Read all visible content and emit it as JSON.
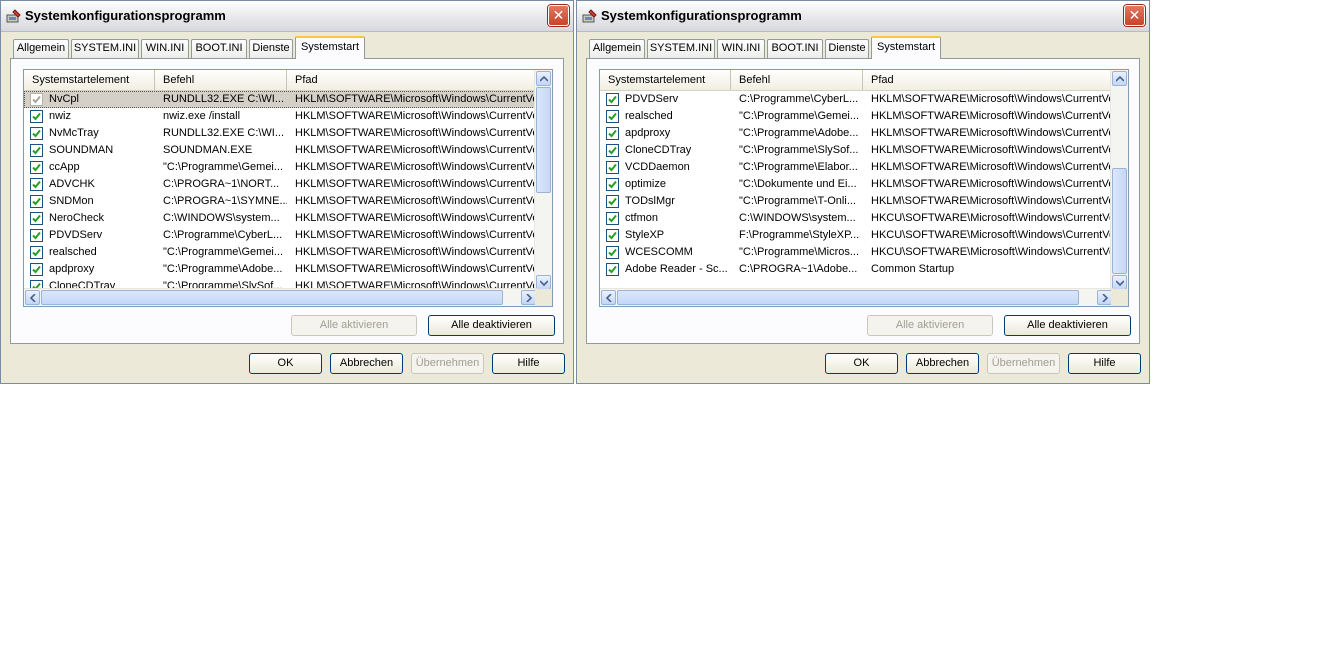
{
  "windows": [
    {
      "title": "Systemkonfigurationsprogramm",
      "tabs": [
        "Allgemein",
        "SYSTEM.INI",
        "WIN.INI",
        "BOOT.INI",
        "Dienste",
        "Systemstart"
      ],
      "active_tab": "Systemstart",
      "columns": [
        "Systemstartelement",
        "Befehl",
        "Pfad"
      ],
      "rows": [
        {
          "name": "NvCpl",
          "cmd": "RUNDLL32.EXE C:\\WI...",
          "path": "HKLM\\SOFTWARE\\Microsoft\\Windows\\CurrentVer...",
          "checked": true,
          "selected": true
        },
        {
          "name": "nwiz",
          "cmd": "nwiz.exe /install",
          "path": "HKLM\\SOFTWARE\\Microsoft\\Windows\\CurrentVer...",
          "checked": true
        },
        {
          "name": "NvMcTray",
          "cmd": "RUNDLL32.EXE C:\\WI...",
          "path": "HKLM\\SOFTWARE\\Microsoft\\Windows\\CurrentVer...",
          "checked": true
        },
        {
          "name": "SOUNDMAN",
          "cmd": "SOUNDMAN.EXE",
          "path": "HKLM\\SOFTWARE\\Microsoft\\Windows\\CurrentVer...",
          "checked": true
        },
        {
          "name": "ccApp",
          "cmd": "\"C:\\Programme\\Gemei...",
          "path": "HKLM\\SOFTWARE\\Microsoft\\Windows\\CurrentVer...",
          "checked": true
        },
        {
          "name": "ADVCHK",
          "cmd": "C:\\PROGRA~1\\NORT...",
          "path": "HKLM\\SOFTWARE\\Microsoft\\Windows\\CurrentVer...",
          "checked": true
        },
        {
          "name": "SNDMon",
          "cmd": "C:\\PROGRA~1\\SYMNE...",
          "path": "HKLM\\SOFTWARE\\Microsoft\\Windows\\CurrentVer...",
          "checked": true
        },
        {
          "name": "NeroCheck",
          "cmd": "C:\\WINDOWS\\system...",
          "path": "HKLM\\SOFTWARE\\Microsoft\\Windows\\CurrentVer...",
          "checked": true
        },
        {
          "name": "PDVDServ",
          "cmd": "C:\\Programme\\CyberL...",
          "path": "HKLM\\SOFTWARE\\Microsoft\\Windows\\CurrentVer...",
          "checked": true
        },
        {
          "name": "realsched",
          "cmd": "\"C:\\Programme\\Gemei...",
          "path": "HKLM\\SOFTWARE\\Microsoft\\Windows\\CurrentVer...",
          "checked": true
        },
        {
          "name": "apdproxy",
          "cmd": "\"C:\\Programme\\Adobe...",
          "path": "HKLM\\SOFTWARE\\Microsoft\\Windows\\CurrentVer...",
          "checked": true
        },
        {
          "name": "CloneCDTray",
          "cmd": "\"C:\\Programme\\SlySof...",
          "path": "HKLM\\SOFTWARE\\Microsoft\\Windows\\CurrentVer...",
          "checked": true
        }
      ],
      "scroll_position": "top",
      "buttons": {
        "enable_all": "Alle aktivieren",
        "disable_all": "Alle deaktivieren",
        "ok": "OK",
        "cancel": "Abbrechen",
        "apply": "Übernehmen",
        "help": "Hilfe"
      }
    },
    {
      "title": "Systemkonfigurationsprogramm",
      "tabs": [
        "Allgemein",
        "SYSTEM.INI",
        "WIN.INI",
        "BOOT.INI",
        "Dienste",
        "Systemstart"
      ],
      "active_tab": "Systemstart",
      "columns": [
        "Systemstartelement",
        "Befehl",
        "Pfad"
      ],
      "rows": [
        {
          "name": "PDVDServ",
          "cmd": "C:\\Programme\\CyberL...",
          "path": "HKLM\\SOFTWARE\\Microsoft\\Windows\\CurrentVer...",
          "checked": true
        },
        {
          "name": "realsched",
          "cmd": "\"C:\\Programme\\Gemei...",
          "path": "HKLM\\SOFTWARE\\Microsoft\\Windows\\CurrentVer...",
          "checked": true
        },
        {
          "name": "apdproxy",
          "cmd": "\"C:\\Programme\\Adobe...",
          "path": "HKLM\\SOFTWARE\\Microsoft\\Windows\\CurrentVer...",
          "checked": true
        },
        {
          "name": "CloneCDTray",
          "cmd": "\"C:\\Programme\\SlySof...",
          "path": "HKLM\\SOFTWARE\\Microsoft\\Windows\\CurrentVer...",
          "checked": true
        },
        {
          "name": "VCDDaemon",
          "cmd": "\"C:\\Programme\\Elabor...",
          "path": "HKLM\\SOFTWARE\\Microsoft\\Windows\\CurrentVer...",
          "checked": true
        },
        {
          "name": "optimize",
          "cmd": "\"C:\\Dokumente und Ei...",
          "path": "HKLM\\SOFTWARE\\Microsoft\\Windows\\CurrentVer...",
          "checked": true
        },
        {
          "name": "TODslMgr",
          "cmd": "\"C:\\Programme\\T-Onli...",
          "path": "HKLM\\SOFTWARE\\Microsoft\\Windows\\CurrentVer...",
          "checked": true
        },
        {
          "name": "ctfmon",
          "cmd": "C:\\WINDOWS\\system...",
          "path": "HKCU\\SOFTWARE\\Microsoft\\Windows\\CurrentVer...",
          "checked": true
        },
        {
          "name": "StyleXP",
          "cmd": "F:\\Programme\\StyleXP...",
          "path": "HKCU\\SOFTWARE\\Microsoft\\Windows\\CurrentVer...",
          "checked": true
        },
        {
          "name": "WCESCOMM",
          "cmd": "\"C:\\Programme\\Micros...",
          "path": "HKCU\\SOFTWARE\\Microsoft\\Windows\\CurrentVer...",
          "checked": true
        },
        {
          "name": "Adobe Reader - Sc...",
          "cmd": "C:\\PROGRA~1\\Adobe...",
          "path": "Common Startup",
          "checked": true
        }
      ],
      "scroll_position": "bottom",
      "buttons": {
        "enable_all": "Alle aktivieren",
        "disable_all": "Alle deaktivieren",
        "ok": "OK",
        "cancel": "Abbrechen",
        "apply": "Übernehmen",
        "help": "Hilfe"
      }
    }
  ],
  "colors": {
    "window_bg": "#ece9d8",
    "close_red": "#c9432a",
    "active_tab_accent": "#ffc83c",
    "check_green": "#21a121"
  }
}
